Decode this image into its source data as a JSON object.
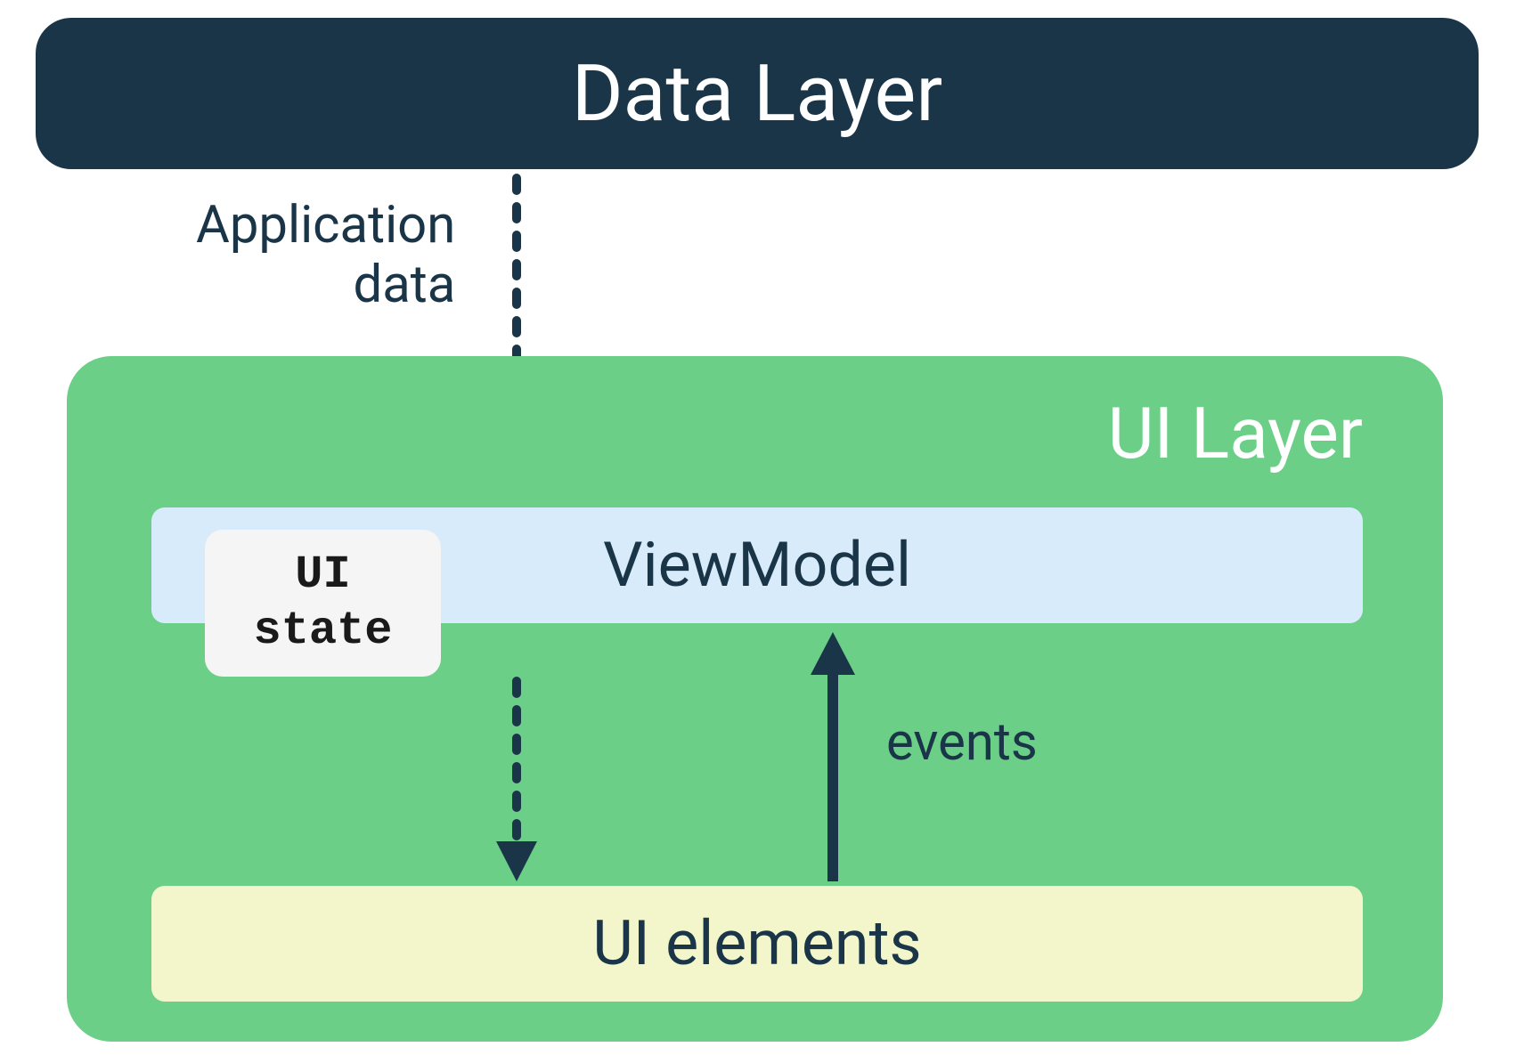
{
  "diagram": {
    "dataLayer": {
      "label": "Data Layer"
    },
    "arrows": {
      "applicationData": {
        "line1": "Application",
        "line2": "data"
      },
      "events": {
        "label": "events"
      }
    },
    "uiLayer": {
      "label": "UI Layer",
      "viewModel": {
        "label": "ViewModel"
      },
      "uiState": {
        "line1": "UI",
        "line2": "state"
      },
      "uiElements": {
        "label": "UI elements"
      }
    }
  },
  "colors": {
    "darkBlue": "#1a3547",
    "green": "#6ccf87",
    "lightBlue": "#d8ebfa",
    "lightYellow": "#f3f6ca",
    "lightGray": "#f5f5f5",
    "white": "#ffffff"
  }
}
